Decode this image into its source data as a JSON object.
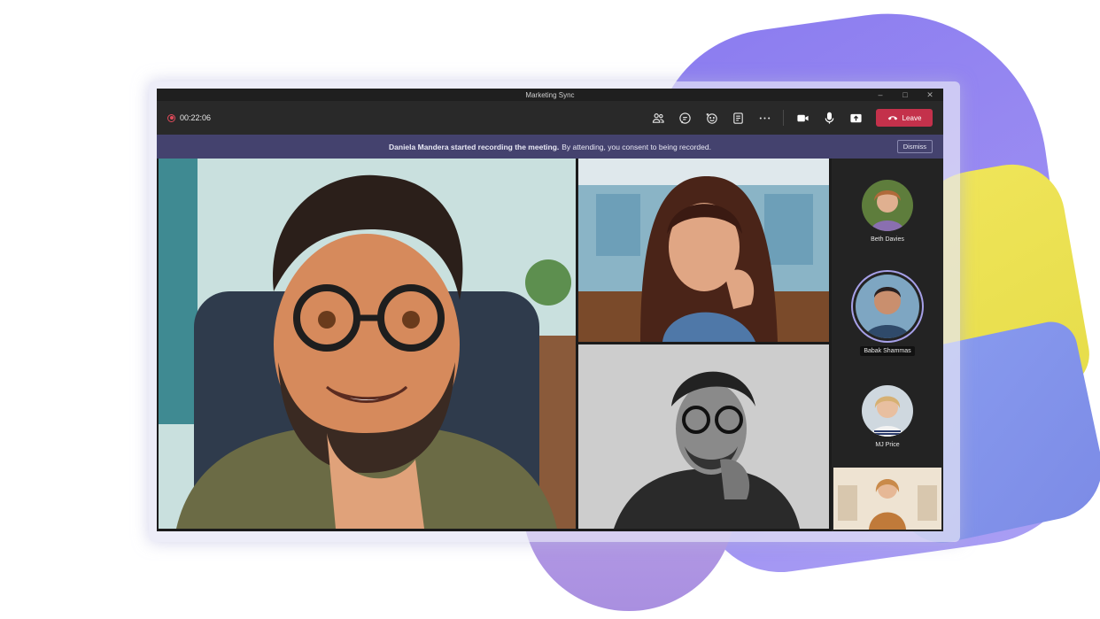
{
  "window": {
    "title": "Marketing Sync"
  },
  "toolbar": {
    "timer": "00:22:06",
    "leave_label": "Leave",
    "icons": [
      "people-icon",
      "chat-icon",
      "reactions-icon",
      "notes-icon",
      "more-icon",
      "camera-icon",
      "mic-icon",
      "share-icon"
    ]
  },
  "banner": {
    "bold_text": "Daniela Mandera started recording the meeting.",
    "text": "By attending, you consent to being recorded.",
    "dismiss_label": "Dismiss"
  },
  "participants": [
    {
      "name": "Beth Davies"
    },
    {
      "name": "Babak Shammas",
      "speaking": true
    },
    {
      "name": "MJ Price"
    }
  ],
  "colors": {
    "leave": "#c4314b",
    "banner": "#44426e",
    "recording": "#e04a5a",
    "speaking_ring": "#a6a0e8"
  }
}
